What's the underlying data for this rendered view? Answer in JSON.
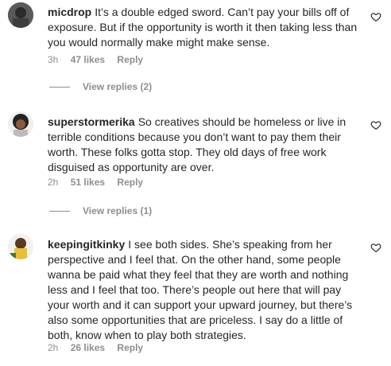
{
  "comments": [
    {
      "username": "micdrop",
      "text": "It’s a double edged sword. Can’t pay your bills off of exposure. But if the opportunity is worth it then taking less than you would normally make might make sense.",
      "time": "3h",
      "likes": "47 likes",
      "reply": "Reply",
      "view_replies": "View replies (2)"
    },
    {
      "username": "superstormerika",
      "text": "So creatives should be homeless or live in terrible conditions because you don’t want to pay them their worth. These folks gotta stop. They old days of free work disguised as opportunity are over.",
      "time": "2h",
      "likes": "51 likes",
      "reply": "Reply",
      "view_replies": "View replies (1)"
    },
    {
      "username": "keepingitkinky",
      "text": "I see both sides. She’s speaking from her perspective and I feel that. On the other hand, some people wanna be paid what they feel that they are worth and nothing less and I feel that too. There’s people out here that will pay your worth and it can support your upward journey, but there’s also some opportunities that are priceless. I say do a little of both, know when to play both strategies.",
      "time": "2h",
      "likes": "26 likes",
      "reply": "Reply"
    }
  ]
}
